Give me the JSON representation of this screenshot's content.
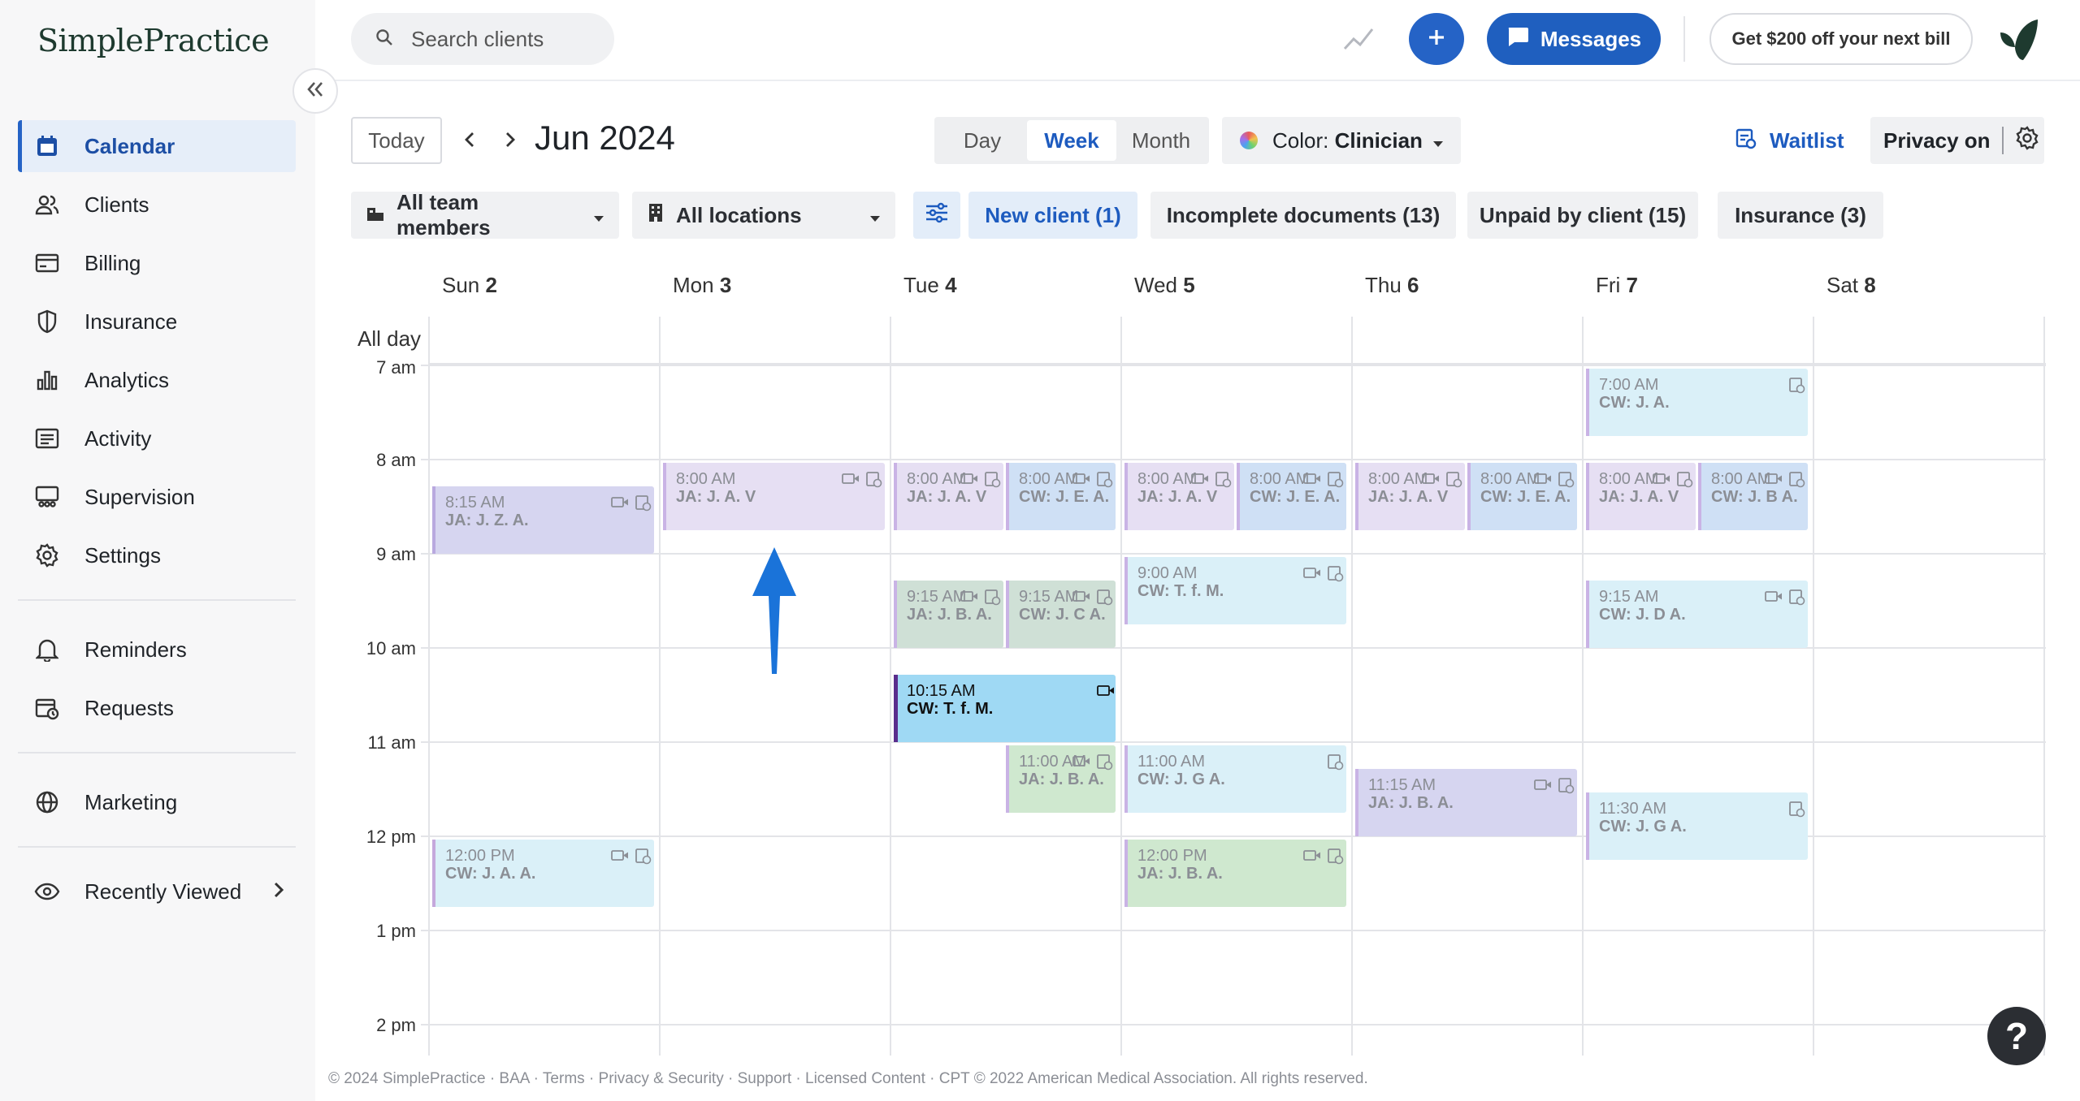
{
  "sidebar": {
    "logo": "SimplePractice",
    "items": [
      {
        "label": "Calendar",
        "icon": "calendar-icon",
        "active": true
      },
      {
        "label": "Clients",
        "icon": "clients-icon"
      },
      {
        "label": "Billing",
        "icon": "billing-icon"
      },
      {
        "label": "Insurance",
        "icon": "insurance-icon"
      },
      {
        "label": "Analytics",
        "icon": "analytics-icon"
      },
      {
        "label": "Activity",
        "icon": "activity-icon"
      },
      {
        "label": "Supervision",
        "icon": "supervision-icon"
      },
      {
        "label": "Settings",
        "icon": "settings-icon"
      },
      {
        "label": "Reminders",
        "icon": "bell-icon"
      },
      {
        "label": "Requests",
        "icon": "requests-icon"
      },
      {
        "label": "Marketing",
        "icon": "globe-icon"
      },
      {
        "label": "Recently Viewed",
        "icon": "eye-icon"
      }
    ]
  },
  "topbar": {
    "search_placeholder": "Search clients",
    "messages_label": "Messages",
    "promo_label": "Get $200 off your next bill"
  },
  "toolbar": {
    "today_label": "Today",
    "month_title": "Jun 2024",
    "views": [
      "Day",
      "Week",
      "Month"
    ],
    "active_view": "Week",
    "color_prefix": "Color: ",
    "color_value": "Clinician",
    "waitlist_label": "Waitlist",
    "privacy_label": "Privacy on"
  },
  "filters": {
    "team": "All team members",
    "locations": "All locations",
    "chips": [
      "New client (1)",
      "Incomplete documents (13)",
      "Unpaid by client (15)",
      "Insurance (3)"
    ]
  },
  "calendar": {
    "days": [
      {
        "name": "Sun",
        "num": "2"
      },
      {
        "name": "Mon",
        "num": "3"
      },
      {
        "name": "Tue",
        "num": "4"
      },
      {
        "name": "Wed",
        "num": "5"
      },
      {
        "name": "Thu",
        "num": "6"
      },
      {
        "name": "Fri",
        "num": "7"
      },
      {
        "name": "Sat",
        "num": "8"
      }
    ],
    "all_day_label": "All day",
    "hours": [
      "7 am",
      "8 am",
      "9 am",
      "10 am",
      "11 am",
      "12 pm",
      "1 pm",
      "2 pm"
    ],
    "colors": {
      "purple": "#e6dff3",
      "lavender": "#d6d5f0",
      "blue": "#cfe0f5",
      "cyan": "#daf0f8",
      "green": "#cfe8cf",
      "sage": "#cfe0d6",
      "bright": "#9fd9f4"
    },
    "events": [
      {
        "day": 0,
        "start": 8.25,
        "end": 9.0,
        "time": "8:15 AM",
        "who": "JA: J. Z. A.",
        "color": "lavender",
        "bar": "#b9a9df",
        "col": 0,
        "cols": 1,
        "video": true
      },
      {
        "day": 0,
        "start": 12.0,
        "end": 12.75,
        "time": "12:00 PM",
        "who": "CW: J. A. A.",
        "color": "cyan",
        "bar": "#c5a8dc",
        "col": 0,
        "cols": 1,
        "video": true
      },
      {
        "day": 1,
        "start": 8.0,
        "end": 8.75,
        "time": "8:00 AM",
        "who": "JA: J. A. V",
        "color": "purple",
        "bar": "#c9b3e5",
        "col": 0,
        "cols": 1,
        "video": true
      },
      {
        "day": 2,
        "start": 8.0,
        "end": 8.75,
        "time": "8:00 AM",
        "who": "JA: J. A. V",
        "color": "purple",
        "bar": "#c9b3e5",
        "col": 0,
        "cols": 2,
        "video": true
      },
      {
        "day": 2,
        "start": 8.0,
        "end": 8.75,
        "time": "8:00 AM",
        "who": "CW: J. E. A.",
        "color": "blue",
        "bar": "#c9b3e5",
        "col": 1,
        "cols": 2,
        "video": true
      },
      {
        "day": 2,
        "start": 9.25,
        "end": 10.0,
        "time": "9:15 AM",
        "who": "JA: J. B. A.",
        "color": "sage",
        "bar": "#c9b3e5",
        "col": 0,
        "cols": 2,
        "video": true
      },
      {
        "day": 2,
        "start": 9.25,
        "end": 10.0,
        "time": "9:15 AM",
        "who": "CW: J. C A.",
        "color": "sage",
        "bar": "#c9b3e5",
        "col": 1,
        "cols": 2,
        "video": true
      },
      {
        "day": 2,
        "start": 10.25,
        "end": 11.0,
        "time": "10:15 AM",
        "who": "CW: T. f. M.",
        "color": "bright",
        "bar": "#5a2d8c",
        "col": 0,
        "cols": 1,
        "video": true,
        "strong": true
      },
      {
        "day": 2,
        "start": 11.0,
        "end": 11.75,
        "time": "11:00 AM",
        "who": "JA: J. B. A.",
        "color": "green",
        "bar": "#c9b3e5",
        "col": 1,
        "cols": 2,
        "video": true
      },
      {
        "day": 3,
        "start": 8.0,
        "end": 8.75,
        "time": "8:00 AM",
        "who": "JA: J. A. V",
        "color": "purple",
        "bar": "#c9b3e5",
        "col": 0,
        "cols": 2,
        "video": true
      },
      {
        "day": 3,
        "start": 8.0,
        "end": 8.75,
        "time": "8:00 AM",
        "who": "CW: J. E. A.",
        "color": "blue",
        "bar": "#c9b3e5",
        "col": 1,
        "cols": 2,
        "video": true
      },
      {
        "day": 3,
        "start": 9.0,
        "end": 9.75,
        "time": "9:00 AM",
        "who": "CW: T. f. M.",
        "color": "cyan",
        "bar": "#c9b3e5",
        "col": 0,
        "cols": 1,
        "video": true
      },
      {
        "day": 3,
        "start": 11.0,
        "end": 11.75,
        "time": "11:00 AM",
        "who": "CW: J. G A.",
        "color": "cyan",
        "bar": "#c9b3e5",
        "col": 0,
        "cols": 1,
        "video": false
      },
      {
        "day": 3,
        "start": 12.0,
        "end": 12.75,
        "time": "12:00 PM",
        "who": "JA: J. B. A.",
        "color": "green",
        "bar": "#c9b3e5",
        "col": 0,
        "cols": 1,
        "video": true
      },
      {
        "day": 4,
        "start": 8.0,
        "end": 8.75,
        "time": "8:00 AM",
        "who": "JA: J. A. V",
        "color": "purple",
        "bar": "#c9b3e5",
        "col": 0,
        "cols": 2,
        "video": true
      },
      {
        "day": 4,
        "start": 8.0,
        "end": 8.75,
        "time": "8:00 AM",
        "who": "CW: J. E. A.",
        "color": "blue",
        "bar": "#c9b3e5",
        "col": 1,
        "cols": 2,
        "video": true
      },
      {
        "day": 4,
        "start": 11.25,
        "end": 12.0,
        "time": "11:15 AM",
        "who": "JA: J. B. A.",
        "color": "lavender",
        "bar": "#c9b3e5",
        "col": 0,
        "cols": 1,
        "video": true
      },
      {
        "day": 5,
        "start": 7.0,
        "end": 7.75,
        "time": "7:00 AM",
        "who": "CW: J. A.",
        "color": "cyan",
        "bar": "#c9b3e5",
        "col": 0,
        "cols": 1,
        "video": false
      },
      {
        "day": 5,
        "start": 8.0,
        "end": 8.75,
        "time": "8:00 AM",
        "who": "JA: J. A. V",
        "color": "purple",
        "bar": "#c9b3e5",
        "col": 0,
        "cols": 2,
        "video": true
      },
      {
        "day": 5,
        "start": 8.0,
        "end": 8.75,
        "time": "8:00 AM",
        "who": "CW: J. B A.",
        "color": "blue",
        "bar": "#c9b3e5",
        "col": 1,
        "cols": 2,
        "video": true
      },
      {
        "day": 5,
        "start": 9.25,
        "end": 10.0,
        "time": "9:15 AM",
        "who": "CW: J. D A.",
        "color": "cyan",
        "bar": "#c9b3e5",
        "col": 0,
        "cols": 1,
        "video": true
      },
      {
        "day": 5,
        "start": 11.5,
        "end": 12.25,
        "time": "11:30 AM",
        "who": "CW: J. G A.",
        "color": "cyan",
        "bar": "#c9b3e5",
        "col": 0,
        "cols": 1,
        "video": false
      }
    ]
  },
  "footer": "© 2024 SimplePractice · BAA · Terms · Privacy & Security · Support · Licensed Content · CPT © 2022 American Medical Association. All rights reserved.",
  "help_label": "?"
}
